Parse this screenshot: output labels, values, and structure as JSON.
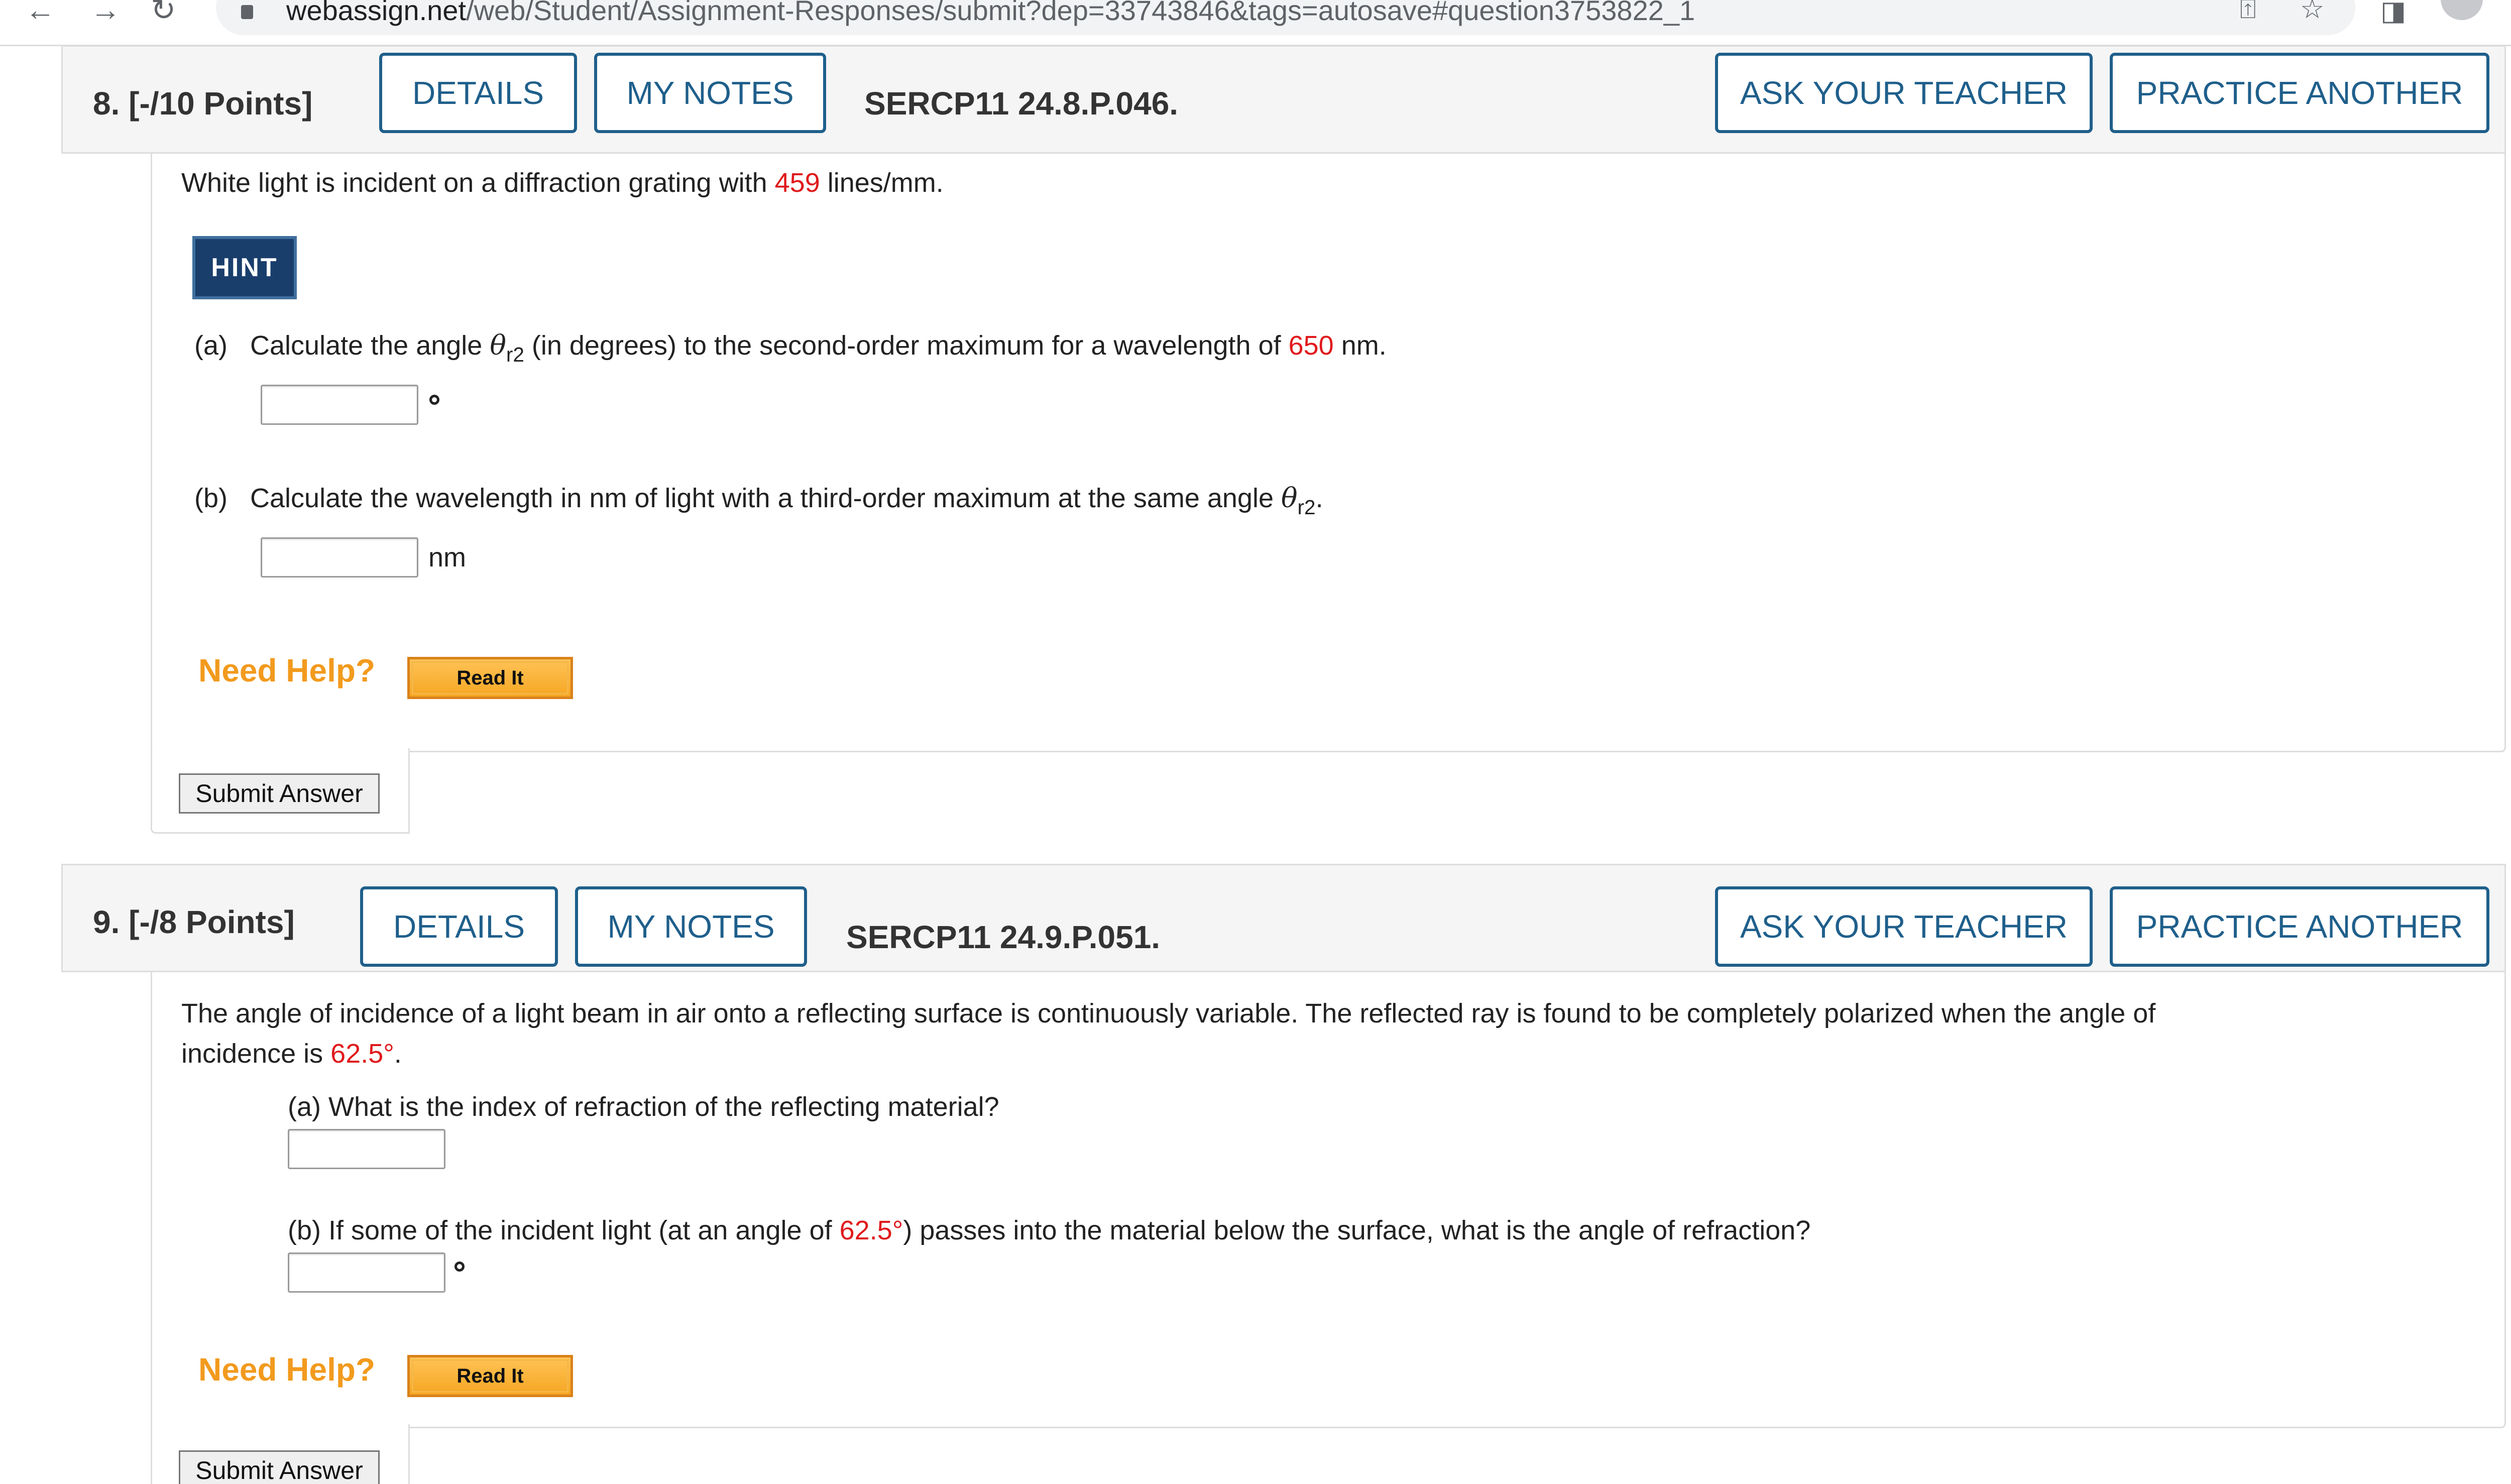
{
  "browser": {
    "url_host": "webassign.net",
    "url_path": "/web/Student/Assignment-Responses/submit?dep=33743846&tags=autosave#question3753822_1"
  },
  "questions": [
    {
      "number_label": "8. [-/10 Points]",
      "details_label": "DETAILS",
      "notes_label": "MY NOTES",
      "code": "SERCP11 24.8.P.046.",
      "ask_label": "ASK YOUR TEACHER",
      "practice_label": "PRACTICE ANOTHER",
      "intro_pre": "White light is incident on a diffraction grating with ",
      "intro_value": "459",
      "intro_post": " lines/mm.",
      "hint_label": "HINT",
      "part_a_label": "(a)",
      "part_a_pre": "Calculate the angle ",
      "part_a_symbol": "θ",
      "part_a_sub": "r2",
      "part_a_mid": " (in degrees) to the second-order maximum for a wavelength of ",
      "part_a_value": "650",
      "part_a_post": " nm.",
      "part_b_label": "(b)",
      "part_b_pre": "Calculate the wavelength in nm of light with a third-order maximum at the same angle ",
      "part_b_symbol": "θ",
      "part_b_sub": "r2",
      "part_b_post": ".",
      "part_b_unit": "nm",
      "need_help_label": "Need Help?",
      "read_it_label": "Read It",
      "submit_label": "Submit Answer"
    },
    {
      "number_label": "9. [-/8 Points]",
      "details_label": "DETAILS",
      "notes_label": "MY NOTES",
      "code": "SERCP11 24.9.P.051.",
      "ask_label": "ASK YOUR TEACHER",
      "practice_label": "PRACTICE ANOTHER",
      "intro_line1": "The angle of incidence of a light beam in air onto a reflecting surface is continuously variable. The reflected ray is found to be completely polarized when the angle of",
      "intro_line2_pre": "incidence is ",
      "intro_value": "62.5°",
      "intro_line2_post": ".",
      "part_a_text": "(a) What is the index of refraction of the reflecting material?",
      "part_b_pre": "(b) If some of the incident light (at an angle of ",
      "part_b_value": "62.5°",
      "part_b_post": ") passes into the material below the surface, what is the angle of refraction?",
      "need_help_label": "Need Help?",
      "read_it_label": "Read It",
      "submit_label": "Submit Answer"
    }
  ],
  "colors": {
    "accent_blue": "#1f5f8b",
    "value_red": "#e0191c",
    "need_help_orange": "#f29a1d",
    "hint_navy": "#1a3e6b"
  }
}
